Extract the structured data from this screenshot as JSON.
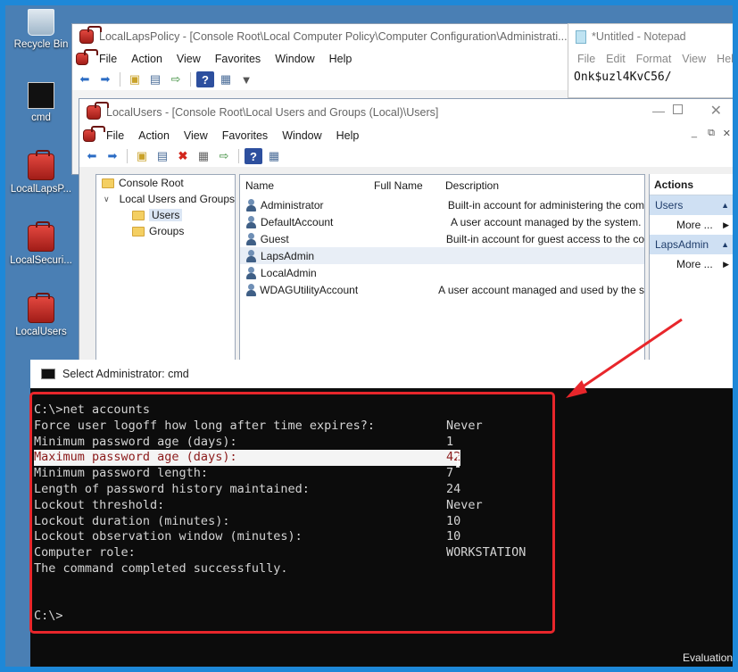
{
  "desktop": {
    "icons": [
      {
        "label": "Recycle Bin",
        "icon": "recycle-bin-icon"
      },
      {
        "label": "cmd",
        "icon": "cmd-shortcut-icon"
      },
      {
        "label": "LocalLapsP...",
        "icon": "toolbox-icon"
      },
      {
        "label": "LocalSecuri...",
        "icon": "toolbox-icon"
      },
      {
        "label": "LocalUsers",
        "icon": "toolbox-icon"
      }
    ],
    "watermark": "Evaluation"
  },
  "laps_window": {
    "title": "LocalLapsPolicy - [Console Root\\Local Computer Policy\\Computer Configuration\\Administrati...",
    "menu": [
      "File",
      "Action",
      "View",
      "Favorites",
      "Window",
      "Help"
    ]
  },
  "notepad": {
    "title": "*Untitled - Notepad",
    "menu": [
      "File",
      "Edit",
      "Format",
      "View",
      "Help"
    ],
    "content": "Onk$uzl4KvC56/"
  },
  "users_window": {
    "title": "LocalUsers - [Console Root\\Local Users and Groups (Local)\\Users]",
    "menu": [
      "File",
      "Action",
      "View",
      "Favorites",
      "Window",
      "Help"
    ],
    "tree": {
      "root": "Console Root",
      "group": "Local Users and Groups",
      "children": [
        "Users",
        "Groups"
      ]
    },
    "columns": [
      "Name",
      "Full Name",
      "Description"
    ],
    "rows": [
      {
        "name": "Administrator",
        "full_name": "",
        "description": "Built-in account for administering the com"
      },
      {
        "name": "DefaultAccount",
        "full_name": "",
        "description": "A user account managed by the system."
      },
      {
        "name": "Guest",
        "full_name": "",
        "description": "Built-in account for guest access to the co"
      },
      {
        "name": "LapsAdmin",
        "full_name": "",
        "description": ""
      },
      {
        "name": "LocalAdmin",
        "full_name": "",
        "description": ""
      },
      {
        "name": "WDAGUtilityAccount",
        "full_name": "",
        "description": "A user account managed and used by the s"
      }
    ],
    "actions": {
      "header": "Actions",
      "group1": "Users",
      "more1": "More ...",
      "group2": "LapsAdmin",
      "more2": "More ..."
    }
  },
  "cmd": {
    "title": "Select Administrator: cmd",
    "command": "C:\\>net accounts",
    "lines": [
      {
        "label": "Force user logoff how long after time expires?:",
        "value": "Never"
      },
      {
        "label": "Minimum password age (days):",
        "value": "1"
      },
      {
        "label": "Maximum password age (days):",
        "value": "42"
      },
      {
        "label": "Minimum password length:",
        "value": "7"
      },
      {
        "label": "Length of password history maintained:",
        "value": "24"
      },
      {
        "label": "Lockout threshold:",
        "value": "Never"
      },
      {
        "label": "Lockout duration (minutes):",
        "value": "10"
      },
      {
        "label": "Lockout observation window (minutes):",
        "value": "10"
      },
      {
        "label": "Computer role:",
        "value": "WORKSTATION"
      }
    ],
    "completed": "The command completed successfully.",
    "prompt": "C:\\>"
  },
  "colors": {
    "highlight_box": "#e8262b",
    "desktop": "#4a7fb4",
    "console_bg": "#0c0c0c"
  }
}
